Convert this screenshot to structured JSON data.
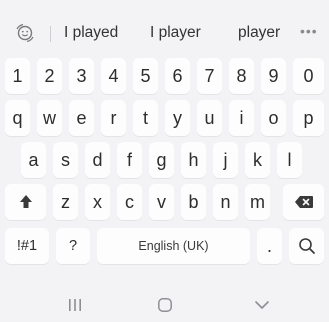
{
  "suggestions": [
    "I played",
    "I player",
    "player"
  ],
  "more_label": "•••",
  "rows": {
    "numbers": [
      "1",
      "2",
      "3",
      "4",
      "5",
      "6",
      "7",
      "8",
      "9",
      "0"
    ],
    "top": [
      "q",
      "w",
      "e",
      "r",
      "t",
      "y",
      "u",
      "i",
      "o",
      "p"
    ],
    "middle": [
      "a",
      "s",
      "d",
      "f",
      "g",
      "h",
      "j",
      "k",
      "l"
    ],
    "bottom": [
      "z",
      "x",
      "c",
      "v",
      "b",
      "n",
      "m"
    ]
  },
  "keys": {
    "symbols": "!#1",
    "question": "?",
    "space": "English (UK)",
    "period": "."
  },
  "icons": {
    "emoji": "emoji-toggle-icon",
    "shift": "shift-arrow-icon",
    "backspace": "backspace-icon",
    "search": "search-icon",
    "nav_recents": "recents-icon",
    "nav_home": "home-icon",
    "nav_back": "back-chevron-icon"
  },
  "colors": {
    "background": "#f3f3f5",
    "key": "#fdfdfd",
    "text": "#2b2b2b",
    "icon": "#8f8f93"
  }
}
